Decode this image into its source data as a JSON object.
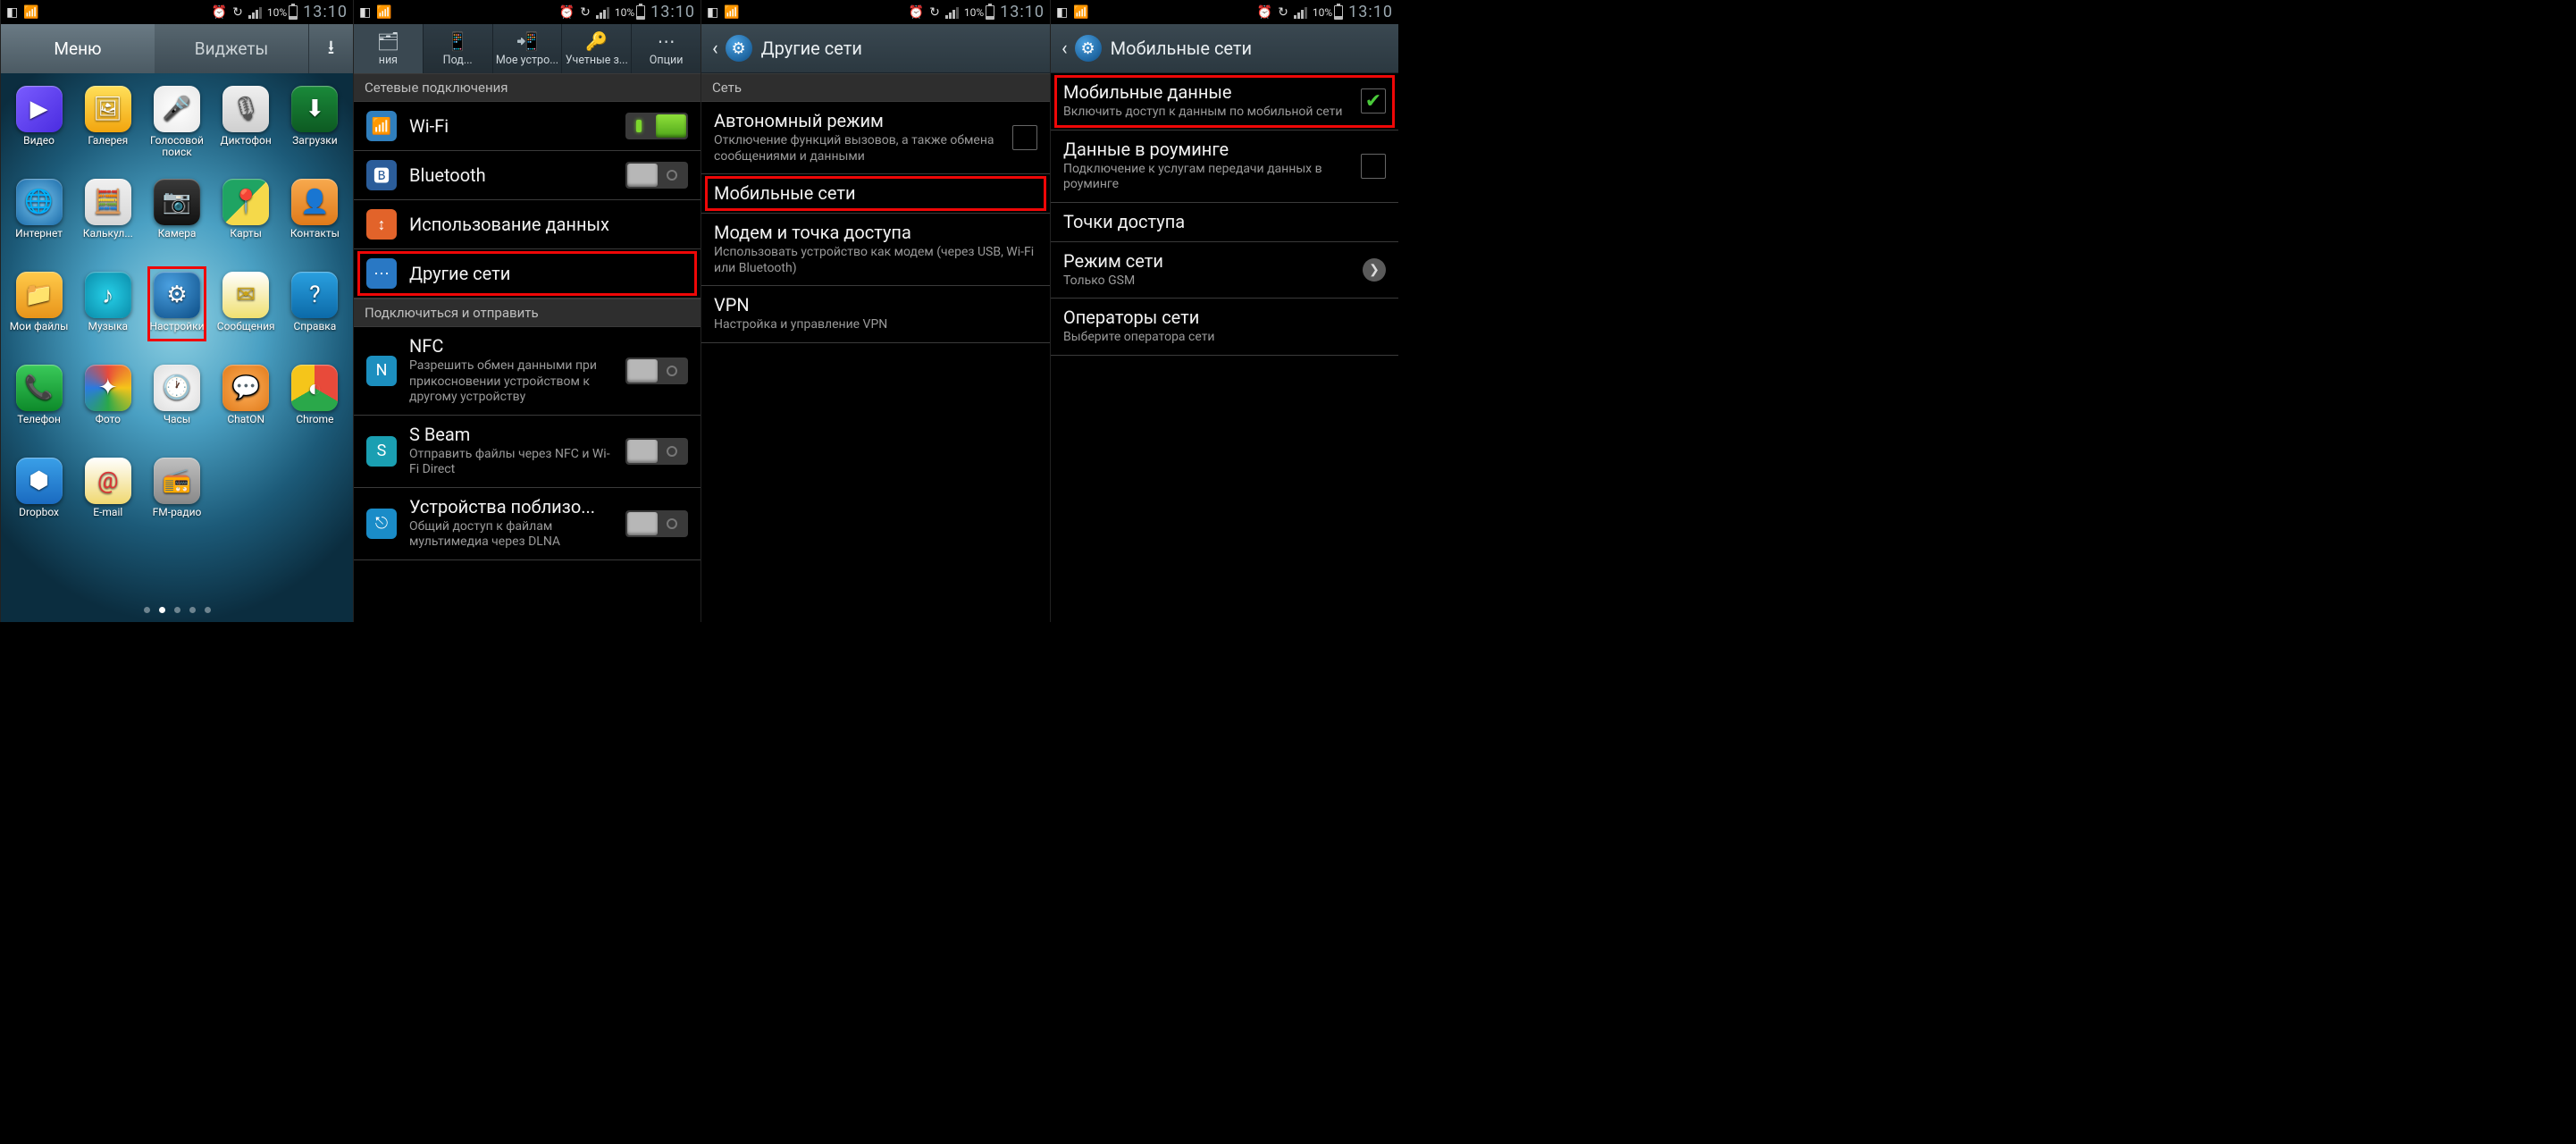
{
  "status": {
    "battery": "10%",
    "time": "13:10"
  },
  "screen1": {
    "tabs": {
      "menu": "Меню",
      "widgets": "Виджеты"
    },
    "apps": [
      {
        "label": "Видео",
        "icon": "▶",
        "bg": "linear-gradient(135deg,#7a5cff,#4a2ce0)",
        "highlight": false
      },
      {
        "label": "Галерея",
        "icon": "🖼",
        "bg": "linear-gradient(#ffe05a,#f2a50e)",
        "highlight": false
      },
      {
        "label": "Голосовой поиск",
        "icon": "🎤",
        "bg": "radial-gradient(circle,#fff,#e8e8e8)",
        "fg": "#d33",
        "highlight": false
      },
      {
        "label": "Диктофон",
        "icon": "🎙",
        "bg": "linear-gradient(#f0f0f0,#cfcfcf)",
        "fg": "#555",
        "highlight": false
      },
      {
        "label": "Загрузки",
        "icon": "⬇",
        "bg": "linear-gradient(#1a8a3a,#0d5a22)",
        "highlight": false
      },
      {
        "label": "Интернет",
        "icon": "🌐",
        "bg": "radial-gradient(circle,#7cc8f0,#1a6aa8)",
        "highlight": false
      },
      {
        "label": "Калькул...",
        "icon": "🧮",
        "bg": "linear-gradient(#f0f0f0,#d7d7d7)",
        "fg": "#e08a1a",
        "highlight": false
      },
      {
        "label": "Камера",
        "icon": "📷",
        "bg": "linear-gradient(#3a3a3a,#111)",
        "highlight": false
      },
      {
        "label": "Карты",
        "icon": "📍",
        "bg": "linear-gradient(135deg,#1fa463 50%,#f5d94a 50%)",
        "highlight": false
      },
      {
        "label": "Контакты",
        "icon": "👤",
        "bg": "linear-gradient(#f7a94e,#e07a1a)",
        "highlight": false
      },
      {
        "label": "Мои файлы",
        "icon": "📁",
        "bg": "linear-gradient(#ffca4a,#e8941a)",
        "highlight": false
      },
      {
        "label": "Музыка",
        "icon": "♪",
        "bg": "radial-gradient(circle,#26d0e8,#0a8aa8)",
        "highlight": false
      },
      {
        "label": "Настройки",
        "icon": "⚙",
        "bg": "radial-gradient(circle at 35% 30%,#4aa0e0,#0c4d86)",
        "highlight": true
      },
      {
        "label": "Сообщения",
        "icon": "✉",
        "bg": "linear-gradient(#fff,#f0e070)",
        "fg": "#caa318",
        "highlight": false
      },
      {
        "label": "Справка",
        "icon": "?",
        "bg": "linear-gradient(#2aa0e0,#0c6aa8)",
        "highlight": false
      },
      {
        "label": "Телефон",
        "icon": "📞",
        "bg": "linear-gradient(#3aca5a,#0d8a2a)",
        "highlight": false
      },
      {
        "label": "Фото",
        "icon": "✦",
        "bg": "conic-gradient(#e84a3a,#f5c51a,#2aa84a,#2a7ae0,#e84a3a)",
        "highlight": false
      },
      {
        "label": "Часы",
        "icon": "🕐",
        "bg": "radial-gradient(circle,#fff,#ddd)",
        "fg": "#333",
        "highlight": false
      },
      {
        "label": "ChatON",
        "icon": "💬",
        "bg": "radial-gradient(circle,#ffb05a,#e07a1a)",
        "highlight": false
      },
      {
        "label": "Chrome",
        "icon": "◐",
        "bg": "conic-gradient(#e84a3a 0 120deg,#2aa84a 120deg 240deg,#f5c51a 240deg 360deg)",
        "highlight": false
      },
      {
        "label": "Dropbox",
        "icon": "⬢",
        "bg": "linear-gradient(#3aa0e8,#1a6ac0)",
        "highlight": false
      },
      {
        "label": "E-mail",
        "icon": "@",
        "bg": "linear-gradient(#fff,#f0d870)",
        "fg": "#d33",
        "highlight": false
      },
      {
        "label": "FM-радио",
        "icon": "📻",
        "bg": "linear-gradient(#c0c0c0,#888)",
        "highlight": false
      }
    ]
  },
  "screen2": {
    "tabs": [
      {
        "label": "ния",
        "icon": "🗂"
      },
      {
        "label": "Под...",
        "icon": "📱"
      },
      {
        "label": "Мое устро...",
        "icon": "📲"
      },
      {
        "label": "Учетные з...",
        "icon": "🔑"
      },
      {
        "label": "Опции",
        "icon": "⋯"
      }
    ],
    "section1": "Сетевые подключения",
    "items1": [
      {
        "title": "Wi-Fi",
        "icon": "wifi",
        "toggle": "on",
        "highlight": false
      },
      {
        "title": "Bluetooth",
        "icon": "bt",
        "toggle": "off",
        "highlight": false
      },
      {
        "title": "Использование данных",
        "icon": "data",
        "highlight": false
      },
      {
        "title": "Другие сети",
        "icon": "more",
        "highlight": true
      }
    ],
    "section2": "Подключиться и отправить",
    "items2": [
      {
        "title": "NFC",
        "sub": "Разрешить обмен данными при прикосновении устройством к другому устройству",
        "icon": "nfc",
        "toggle": "off"
      },
      {
        "title": "S Beam",
        "sub": "Отправить файлы через NFC и Wi-Fi Direct",
        "icon": "sbeam",
        "toggle": "off"
      },
      {
        "title": "Устройства поблизо...",
        "sub": "Общий доступ к файлам мультимедиа через DLNA",
        "icon": "near",
        "toggle": "off"
      }
    ]
  },
  "screen3": {
    "title": "Другие сети",
    "section": "Сеть",
    "items": [
      {
        "title": "Автономный режим",
        "sub": "Отключение функций вызовов, а также обмена сообщениями и данными",
        "check": false,
        "highlight": false
      },
      {
        "title": "Мобильные сети",
        "highlight": true
      },
      {
        "title": "Модем и точка доступа",
        "sub": "Использовать устройство как модем (через USB, Wi-Fi или Bluetooth)",
        "highlight": false
      },
      {
        "title": "VPN",
        "sub": "Настройка и управление VPN",
        "highlight": false
      }
    ]
  },
  "screen4": {
    "title": "Мобильные сети",
    "items": [
      {
        "title": "Мобильные данные",
        "sub": "Включить доступ к данным по мобильной сети",
        "check": true,
        "highlight": true
      },
      {
        "title": "Данные в роуминге",
        "sub": "Подключение к услугам передачи данных в роуминге",
        "check": false,
        "highlight": false
      },
      {
        "title": "Точки доступа",
        "highlight": false
      },
      {
        "title": "Режим сети",
        "sub": "Только GSM",
        "chev": true,
        "highlight": false
      },
      {
        "title": "Операторы сети",
        "sub": "Выберите оператора сети",
        "highlight": false
      }
    ]
  }
}
